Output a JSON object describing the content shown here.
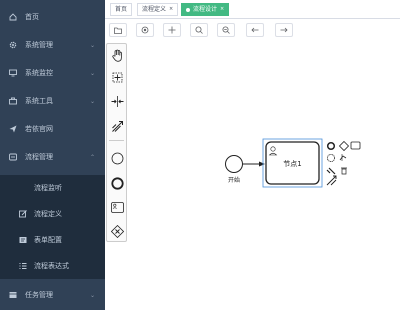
{
  "sidebar": {
    "items": [
      {
        "label": "首页",
        "icon": "home-icon"
      },
      {
        "label": "系统管理",
        "icon": "gear-icon"
      },
      {
        "label": "系统监控",
        "icon": "monitor-icon"
      },
      {
        "label": "系统工具",
        "icon": "toolbox-icon"
      },
      {
        "label": "若依官网",
        "icon": "send-icon"
      },
      {
        "label": "流程管理",
        "icon": "workflow-icon"
      },
      {
        "label": "任务管理",
        "icon": "task-icon"
      }
    ],
    "subitems": [
      {
        "label": "流程监听",
        "icon": ""
      },
      {
        "label": "流程定义",
        "icon": "edit-icon"
      },
      {
        "label": "表单配置",
        "icon": "form-icon"
      },
      {
        "label": "流程表达式",
        "icon": "list-icon"
      }
    ]
  },
  "tags": [
    {
      "label": "首页",
      "active": false
    },
    {
      "label": "流程定义",
      "active": false,
      "close": "×"
    },
    {
      "label": "流程设计",
      "active": true,
      "close": "×"
    }
  ],
  "toolbar": {
    "buttons": [
      "folder-icon",
      "target-icon",
      "crosshair-icon",
      "zoom-in-icon",
      "zoom-out-icon",
      "undo-icon",
      "redo-icon"
    ]
  },
  "diagram": {
    "start_label": "开始",
    "task_label": "节点1"
  },
  "colors": {
    "sidebar_bg": "#304156",
    "submenu_bg": "#1f2d3d",
    "active_tag": "#42b983",
    "selection": "#4a90d9"
  }
}
